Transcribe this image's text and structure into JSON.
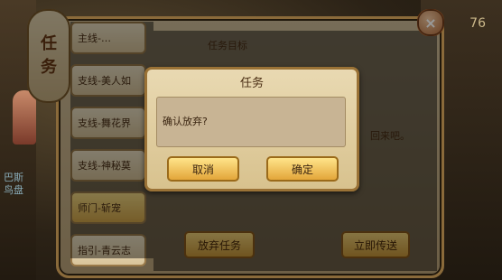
{
  "panel": {
    "title_chars": [
      "任",
      "务"
    ],
    "close_label": "×",
    "task_items": [
      {
        "label": "主线-…"
      },
      {
        "label": "支线-美人如"
      },
      {
        "label": "支线-舞花界"
      },
      {
        "label": "支线-神秘莫"
      },
      {
        "label": "师门-斩宠"
      },
      {
        "label": "指引-青云志"
      }
    ],
    "detail_title": "任务目标",
    "detail_text": "回来吧。",
    "abandon_label": "放弃任务",
    "deliver_label": "立即传送"
  },
  "dialog": {
    "title": "任务",
    "message": "确认放弃?",
    "cancel_label": "取消",
    "confirm_label": "确定"
  },
  "scene": {
    "top_right_number": "76",
    "side_labels": [
      "巴斯",
      "鸟盘"
    ]
  }
}
